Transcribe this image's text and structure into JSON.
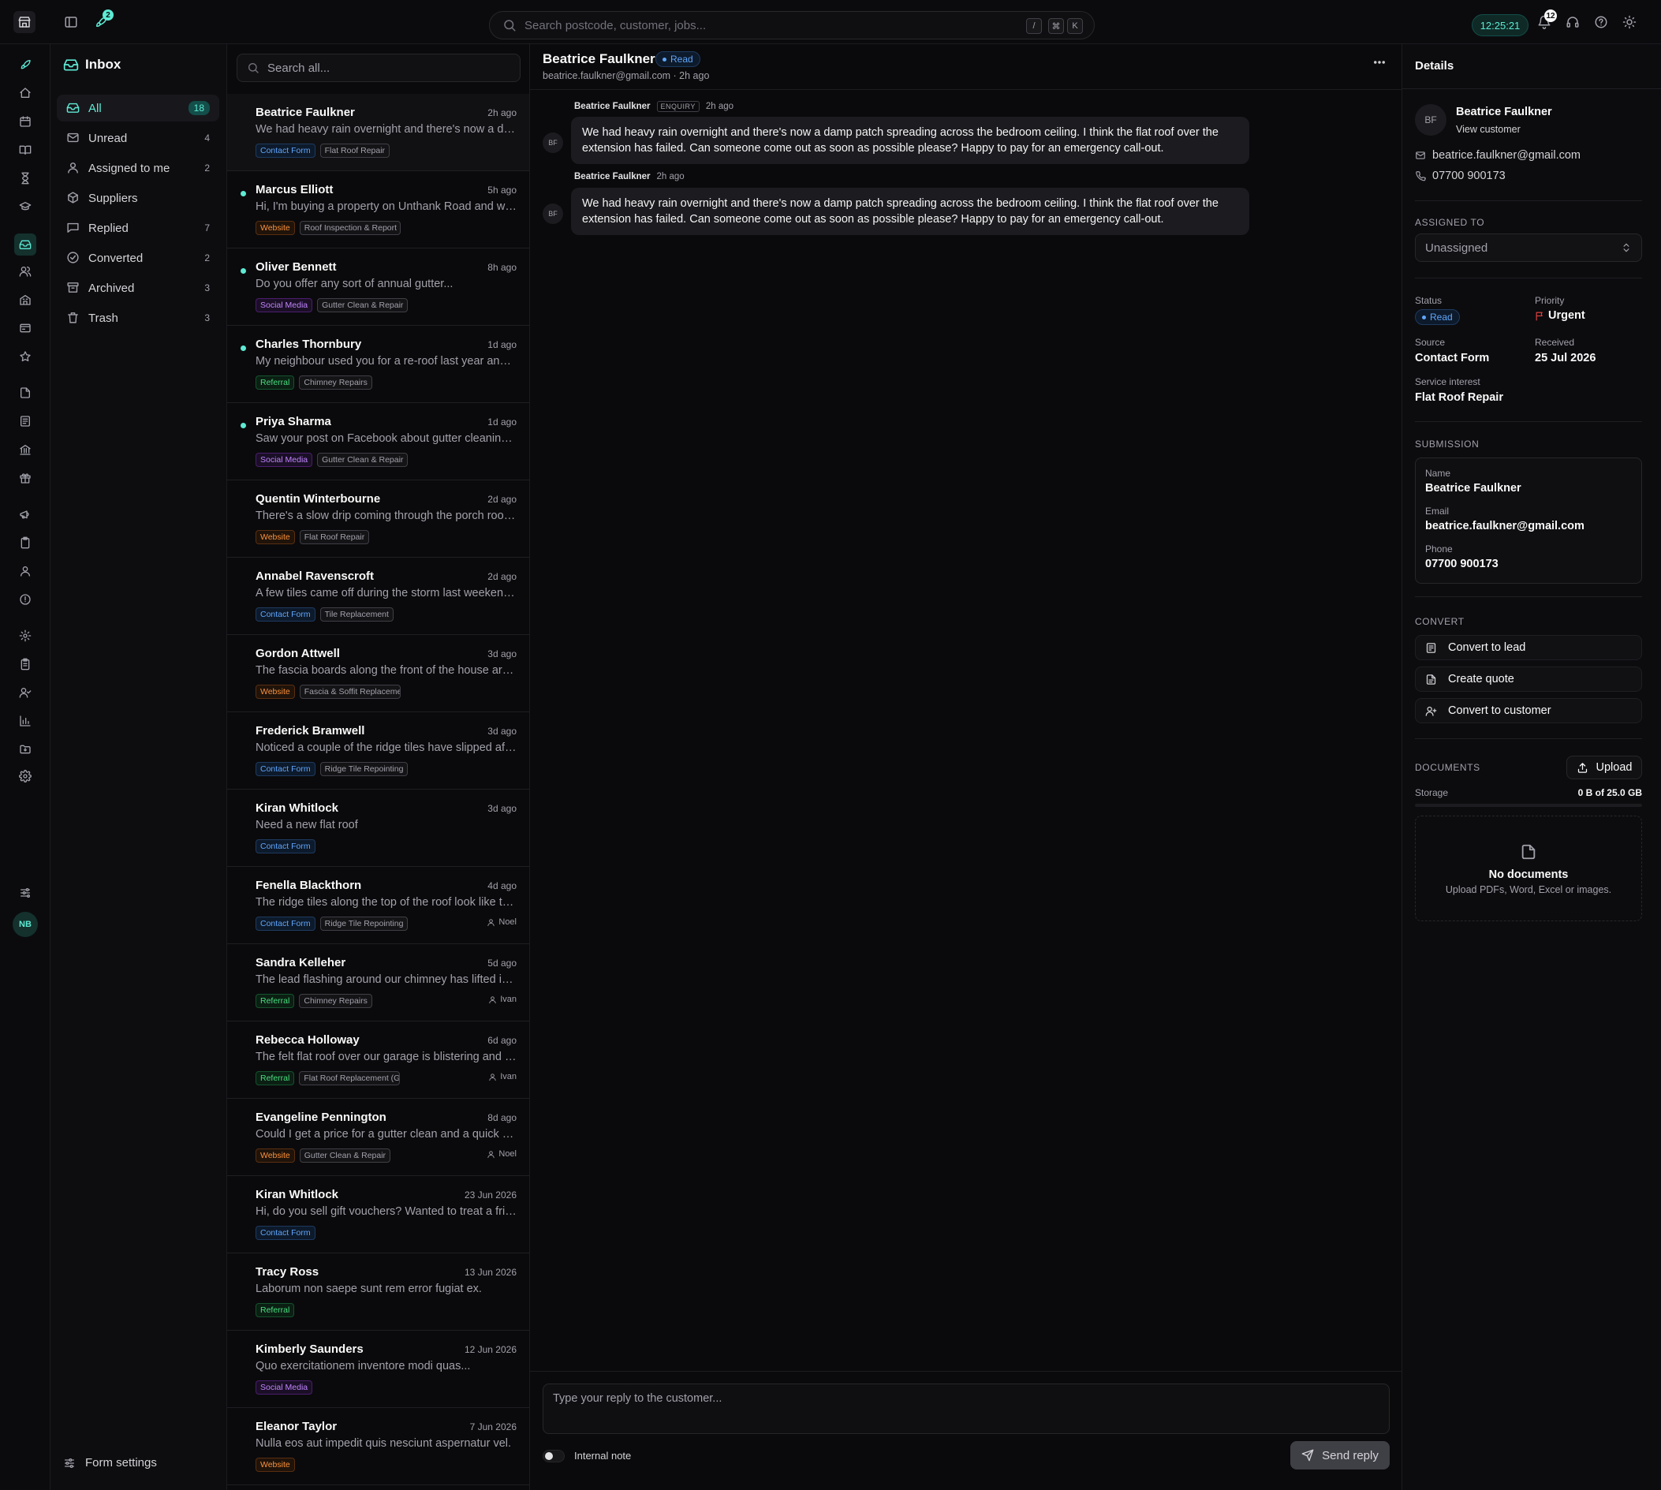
{
  "topbar": {
    "rocket_badge": "2",
    "search_placeholder": "Search postcode, customer, jobs...",
    "kbd_slash": "/",
    "kbd_cmd": "⌘",
    "kbd_k": "K",
    "clock": "12:25:21",
    "notifications_count": "12"
  },
  "rail": {
    "icons": [
      "rocket-icon",
      "home-icon",
      "calendar-icon",
      "book-icon",
      "hourglass-icon",
      "graduation-cap-icon",
      "inbox-icon",
      "users-icon",
      "building-icon",
      "id-card-icon",
      "star-icon",
      "file-icon",
      "document-icon",
      "bank-icon",
      "gift-icon",
      "megaphone-icon",
      "clipboard-icon",
      "team-icon",
      "alert-circle-icon",
      "cog-sparkle-icon",
      "clipboard-list-icon",
      "user-check-icon",
      "bar-chart-icon",
      "folder-icon",
      "settings-icon"
    ],
    "avatar_initials": "NB"
  },
  "inbox": {
    "title": "Inbox",
    "folders": [
      {
        "label": "All",
        "count": "18",
        "icon": "inbox-icon"
      },
      {
        "label": "Unread",
        "count": "4",
        "icon": "mail-icon"
      },
      {
        "label": "Assigned to me",
        "count": "2",
        "icon": "user-icon"
      },
      {
        "label": "Suppliers",
        "count": "",
        "icon": "truck-icon"
      },
      {
        "label": "Replied",
        "count": "7",
        "icon": "reply-icon"
      },
      {
        "label": "Converted",
        "count": "2",
        "icon": "check-circle-icon"
      },
      {
        "label": "Archived",
        "count": "3",
        "icon": "archive-icon"
      },
      {
        "label": "Trash",
        "count": "3",
        "icon": "trash-icon"
      }
    ],
    "form_settings": "Form settings"
  },
  "list": {
    "search_placeholder": "Search all...",
    "messages": [
      {
        "name": "Beatrice Faulkner",
        "time": "2h ago",
        "preview": "We had heavy rain overnight and there's now a damp patch spreading across the bedroom ceiling.",
        "source": "Contact Form",
        "service": "Flat Roof Repair",
        "unread": false,
        "assignee": ""
      },
      {
        "name": "Marcus Elliott",
        "time": "5h ago",
        "preview": "Hi, I'm buying a property on Unthank Road and would like a roof inspection.",
        "source": "Website",
        "service": "Roof Inspection & Report",
        "unread": true,
        "assignee": ""
      },
      {
        "name": "Oliver Bennett",
        "time": "8h ago",
        "preview": "Do you offer any sort of annual gutter...",
        "source": "Social Media",
        "service": "Gutter Clean & Repair",
        "unread": true,
        "assignee": ""
      },
      {
        "name": "Charles Thornbury",
        "time": "1d ago",
        "preview": "My neighbour used you for a re-roof last year and recommended you.",
        "source": "Referral",
        "service": "Chimney Repairs",
        "unread": true,
        "assignee": ""
      },
      {
        "name": "Priya Sharma",
        "time": "1d ago",
        "preview": "Saw your post on Facebook about gutter cleaning and wondered if you cover our area.",
        "source": "Social Media",
        "service": "Gutter Clean & Repair",
        "unread": true,
        "assignee": ""
      },
      {
        "name": "Quentin Winterbourne",
        "time": "2d ago",
        "preview": "There's a slow drip coming through the porch roof whenever it rains.",
        "source": "Website",
        "service": "Flat Roof Repair",
        "unread": false,
        "assignee": ""
      },
      {
        "name": "Annabel Ravenscroft",
        "time": "2d ago",
        "preview": "A few tiles came off during the storm last weekend and need replacing.",
        "source": "Contact Form",
        "service": "Tile Replacement",
        "unread": false,
        "assignee": ""
      },
      {
        "name": "Gordon Attwell",
        "time": "3d ago",
        "preview": "The fascia boards along the front of the house are rotting in places.",
        "source": "Website",
        "service": "Fascia & Soffit Replacement",
        "unread": false,
        "assignee": ""
      },
      {
        "name": "Frederick Bramwell",
        "time": "3d ago",
        "preview": "Noticed a couple of the ridge tiles have slipped after the wind.",
        "source": "Contact Form",
        "service": "Ridge Tile Repointing",
        "unread": false,
        "assignee": ""
      },
      {
        "name": "Kiran Whitlock",
        "time": "3d ago",
        "preview": "Need a new flat roof",
        "source": "Contact Form",
        "service": "",
        "unread": false,
        "assignee": ""
      },
      {
        "name": "Fenella Blackthorn",
        "time": "4d ago",
        "preview": "The ridge tiles along the top of the roof look like they need attention.",
        "source": "Contact Form",
        "service": "Ridge Tile Repointing",
        "unread": false,
        "assignee": "Noel"
      },
      {
        "name": "Sandra Kelleher",
        "time": "5d ago",
        "preview": "The lead flashing around our chimney has lifted in the wind.",
        "source": "Referral",
        "service": "Chimney Repairs",
        "unread": false,
        "assignee": "Ivan"
      },
      {
        "name": "Rebecca Holloway",
        "time": "6d ago",
        "preview": "The felt flat roof over our garage is blistering and letting water in.",
        "source": "Referral",
        "service": "Flat Roof Replacement (GRP)",
        "unread": false,
        "assignee": "Ivan"
      },
      {
        "name": "Evangeline Pennington",
        "time": "8d ago",
        "preview": "Could I get a price for a gutter clean and a quick check of the roof?",
        "source": "Website",
        "service": "Gutter Clean & Repair",
        "unread": false,
        "assignee": "Noel"
      },
      {
        "name": "Kiran Whitlock",
        "time": "23 Jun 2026",
        "preview": "Hi, do you sell gift vouchers? Wanted to treat a friend.",
        "source": "Contact Form",
        "service": "",
        "unread": false,
        "assignee": ""
      },
      {
        "name": "Tracy Ross",
        "time": "13 Jun 2026",
        "preview": "Laborum non saepe sunt rem error fugiat ex.",
        "source": "Referral",
        "service": "",
        "unread": false,
        "assignee": ""
      },
      {
        "name": "Kimberly Saunders",
        "time": "12 Jun 2026",
        "preview": "Quo exercitationem inventore modi quas...",
        "source": "Social Media",
        "service": "",
        "unread": false,
        "assignee": ""
      },
      {
        "name": "Eleanor Taylor",
        "time": "7 Jun 2026",
        "preview": "Nulla eos aut impedit quis nesciunt aspernatur vel.",
        "source": "Website",
        "service": "",
        "unread": false,
        "assignee": ""
      }
    ]
  },
  "conversation": {
    "name": "Beatrice Faulkner",
    "status": "Read",
    "subtitle": "beatrice.faulkner@gmail.com · 2h ago",
    "messages": [
      {
        "sender": "Beatrice Faulkner",
        "tag": "ENQUIRY",
        "time": "2h ago",
        "avatar": "BF",
        "text": "We had heavy rain overnight and there's now a damp patch spreading across the bedroom ceiling. I think the flat roof over the extension has failed. Can someone come out as soon as possible please? Happy to pay for an emergency call-out."
      },
      {
        "sender": "Beatrice Faulkner",
        "tag": "",
        "time": "2h ago",
        "avatar": "BF",
        "text": "We had heavy rain overnight and there's now a damp patch spreading across the bedroom ceiling. I think the flat roof over the extension has failed. Can someone come out as soon as possible please? Happy to pay for an emergency call-out."
      }
    ],
    "reply_placeholder": "Type your reply to the customer...",
    "internal_note": "Internal note",
    "send_label": "Send reply"
  },
  "details": {
    "title": "Details",
    "avatar": "BF",
    "customer_name": "Beatrice Faulkner",
    "view_customer": "View customer",
    "email": "beatrice.faulkner@gmail.com",
    "phone": "07700 900173",
    "assigned_to_label": "ASSIGNED TO",
    "assigned_to_value": "Unassigned",
    "status_label": "Status",
    "status_value": "Read",
    "priority_label": "Priority",
    "priority_value": "Urgent",
    "source_label": "Source",
    "source_value": "Contact Form",
    "received_label": "Received",
    "received_value": "25 Jul 2026",
    "service_label": "Service interest",
    "service_value": "Flat Roof Repair",
    "submission_label": "SUBMISSION",
    "submission": {
      "name_label": "Name",
      "name_value": "Beatrice Faulkner",
      "email_label": "Email",
      "email_value": "beatrice.faulkner@gmail.com",
      "phone_label": "Phone",
      "phone_value": "07700 900173"
    },
    "convert_label": "CONVERT",
    "convert_lead": "Convert to lead",
    "create_quote": "Create quote",
    "convert_customer": "Convert to customer",
    "documents_label": "DOCUMENTS",
    "upload_label": "Upload",
    "storage_label": "Storage",
    "storage_value": "0 B of 25.0 GB",
    "storage_fraction": 0,
    "no_docs_title": "No documents",
    "no_docs_sub": "Upload PDFs, Word, Excel or images."
  },
  "colors": {
    "accent": "#5eead4",
    "background": "#09090b",
    "urgent": "#ef4444",
    "read": "#60a5fa"
  }
}
